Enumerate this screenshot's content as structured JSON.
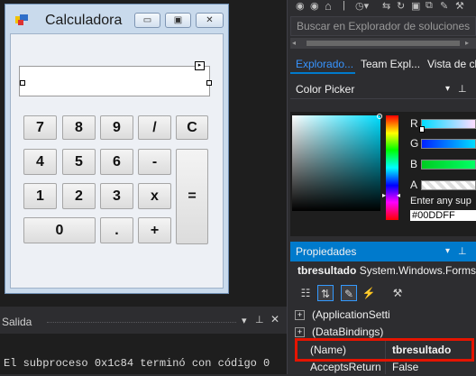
{
  "form": {
    "title": "Calculadora",
    "caption_buttons": [
      "▭",
      "▣",
      "✕"
    ],
    "keys": [
      {
        "label": "7"
      },
      {
        "label": "8"
      },
      {
        "label": "9"
      },
      {
        "label": "/"
      },
      {
        "label": "C"
      },
      {
        "label": "4"
      },
      {
        "label": "5"
      },
      {
        "label": "6"
      },
      {
        "label": "-"
      },
      {
        "label": "1"
      },
      {
        "label": "2"
      },
      {
        "label": "3"
      },
      {
        "label": "x"
      },
      {
        "label": "="
      },
      {
        "label": "0"
      },
      {
        "label": "."
      },
      {
        "label": "+"
      }
    ]
  },
  "solution_explorer": {
    "search_placeholder": "Buscar en Explorador de soluciones"
  },
  "tabs": [
    "Explorado...",
    "Team Expl...",
    "Vista de cl"
  ],
  "color_picker": {
    "title": "Color Picker",
    "channels": [
      {
        "label": "R",
        "color": "#00ddff"
      },
      {
        "label": "G",
        "color": "#0022ff"
      },
      {
        "label": "B",
        "color": "#00cc22"
      },
      {
        "label": "A",
        "color": "#ffffff"
      }
    ],
    "enter_hint": "Enter any sup",
    "hex_value": "#00DDFF",
    "selected_color": "#00DDFF"
  },
  "properties": {
    "title": "Propiedades",
    "object_name": "tbresultado",
    "object_type": "System.Windows.Forms",
    "rows": [
      {
        "name": "(ApplicationSetti",
        "value": "",
        "expandable": true
      },
      {
        "name": "(DataBindings)",
        "value": "",
        "expandable": true
      },
      {
        "name": "(Name)",
        "value": "tbresultado",
        "expandable": false
      },
      {
        "name": "AcceptsReturn",
        "value": "False",
        "expandable": false
      }
    ]
  },
  "output": {
    "title": "Salida",
    "line": "El subproceso 0x1c84 terminó con código 0"
  },
  "colors": {
    "accent": "#007acc",
    "highlight": "#e51400"
  }
}
